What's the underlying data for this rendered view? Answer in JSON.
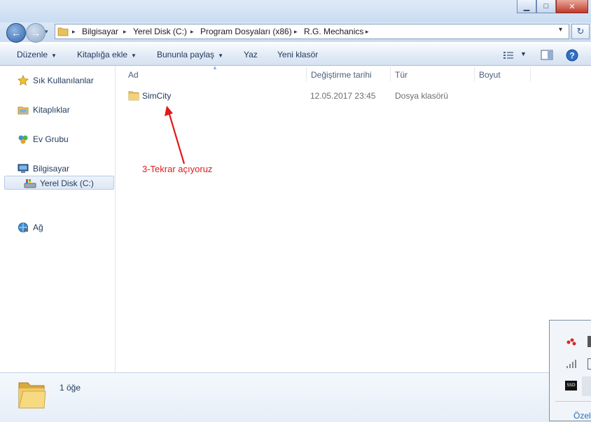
{
  "window": {
    "minimize_glyph": "▁",
    "maximize_glyph": "□",
    "close_glyph": "✕"
  },
  "address": {
    "breadcrumbs": [
      "Bilgisayar",
      "Yerel Disk (C:)",
      "Program Dosyaları (x86)",
      "R.G. Mechanics"
    ],
    "separator": "▸",
    "dropdown_glyph": "▾",
    "back_glyph": "←",
    "forward_glyph": "→",
    "refresh_glyph": "↻"
  },
  "toolbar": {
    "organize": "Düzenle",
    "include_library": "Kitaplığa ekle",
    "share_with": "Bununla paylaş",
    "burn": "Yaz",
    "new_folder": "Yeni klasör",
    "caret": "▼"
  },
  "navigation": {
    "favorites": "Sık Kullanılanlar",
    "libraries": "Kitaplıklar",
    "homegroup": "Ev Grubu",
    "computer": "Bilgisayar",
    "local_disk": "Yerel Disk (C:)",
    "network": "Ağ"
  },
  "columns": {
    "name": "Ad",
    "date_modified": "Değiştirme tarihi",
    "type": "Tür",
    "size": "Boyut"
  },
  "files": [
    {
      "name": "SimCity",
      "date_modified": "12.05.2017 23:45",
      "type": "Dosya klasörü",
      "size": ""
    }
  ],
  "annotation": {
    "text": "3-Tekrar açıyoruz",
    "color": "#e01b1b"
  },
  "status": {
    "item_count": "1 öğe"
  },
  "tray_popup": {
    "ssd_label": "SSD",
    "footer_text": "Özel"
  },
  "colors": {
    "accent": "#1e395b",
    "folder": "#e8c15a",
    "annotation": "#e01b1b"
  }
}
